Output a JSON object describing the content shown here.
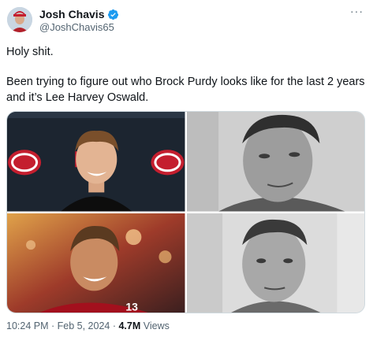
{
  "author": {
    "name": "Josh Chavis",
    "handle": "@JoshChavis65",
    "verified_icon": "verified-badge-icon",
    "more_icon": "more-options-icon"
  },
  "tweet": {
    "line1": "Holy shit.",
    "line2": "Been trying to figure out who Brock Purdy looks like for the last 2 years and it’s Lee Harvey Oswald."
  },
  "media": {
    "images": [
      "press-conference-photo",
      "black-white-portrait-photo",
      "stadium-smile-photo",
      "mugshot-photo"
    ]
  },
  "meta": {
    "time": "10:24 PM",
    "sep1": " · ",
    "date": "Feb 5, 2024",
    "sep2": " · ",
    "views_count": "4.7M",
    "views_label": " Views"
  },
  "colors": {
    "verified": "#1d9bf0",
    "text": "#0f1419",
    "secondary": "#536471",
    "niners_red": "#aa0000",
    "niners_gold": "#b3995d"
  }
}
